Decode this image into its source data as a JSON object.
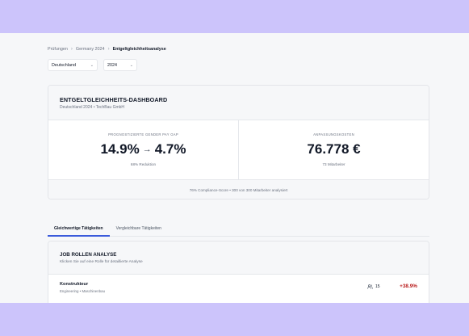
{
  "breadcrumb": {
    "items": [
      "Prüfungen",
      "Germany 2024"
    ],
    "current": "Entgeltgleichheitsanalyse"
  },
  "filters": {
    "country": "Deutschland",
    "year": "2024"
  },
  "dashboard": {
    "title": "ENTGELTGLEICHHEITS-DASHBOARD",
    "subtitle": "Deutschland 2024 • TechBau GmbH",
    "gap": {
      "label": "PROGNOSTIZIERTE GENDER PAY GAP",
      "from": "14.9%",
      "arrow": "→",
      "to": "4.7%",
      "sub": "68% Reduktion"
    },
    "cost": {
      "label": "ANPASSUNGSKOSTEN",
      "value": "76.778 €",
      "sub": "73 Mitarbeiter"
    },
    "footer": "76% Compliance-Score • 300 von 300 Mitarbeiter analysiert"
  },
  "tabs": [
    {
      "label": "Gleichwertige Tätigkeiten",
      "active": true
    },
    {
      "label": "Vergleichbare Tätigkeiten",
      "active": false
    }
  ],
  "job_roles": {
    "title": "JOB ROLLEN ANALYSE",
    "subtitle": "Klicken Sie auf eine Rolle für detaillierte Analyse",
    "rows": [
      {
        "name": "Konstrukteur",
        "department": "Engineering",
        "dot": "•",
        "area": "Maschinenbau",
        "count": "15",
        "gap": "+38.9%"
      }
    ]
  },
  "colors": {
    "accent": "#3b5bdb",
    "negative": "#b91c1c",
    "frame": "#ccc4fb"
  },
  "icons": {
    "breadcrumb_separator": "chevron-right-icon",
    "select": "chevron-down-icon",
    "employees": "users-icon"
  }
}
